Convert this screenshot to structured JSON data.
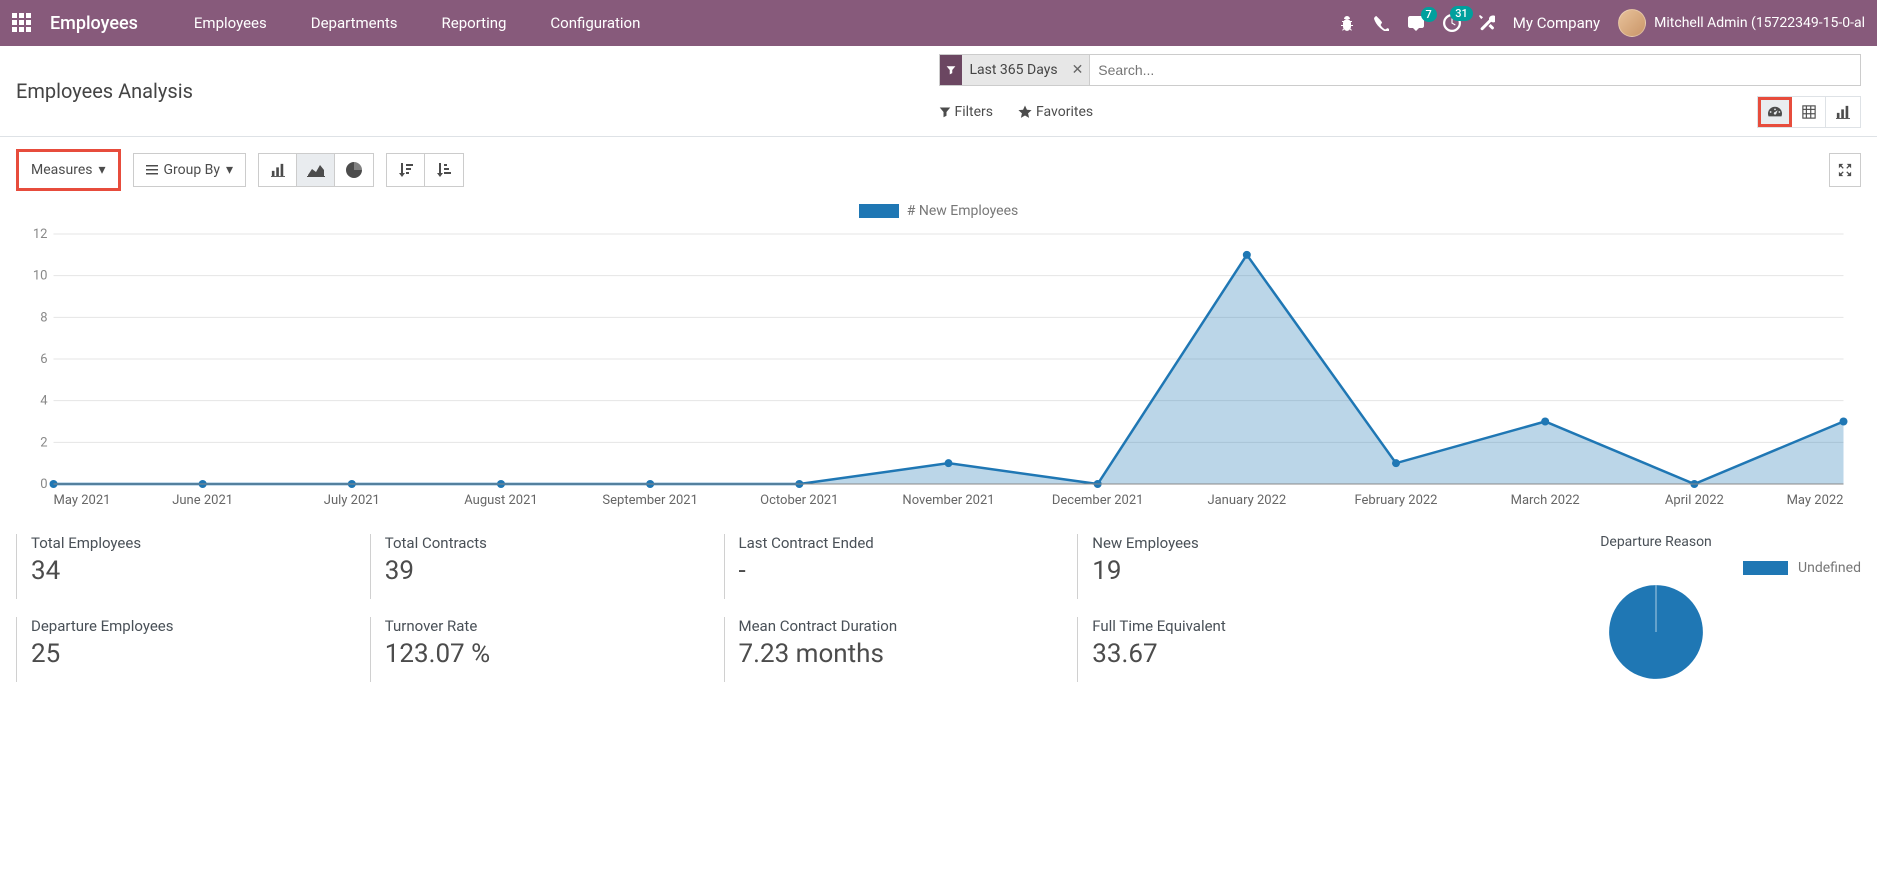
{
  "navbar": {
    "brand": "Employees",
    "links": [
      "Employees",
      "Departments",
      "Reporting",
      "Configuration"
    ],
    "msg_badge": "7",
    "act_badge": "31",
    "company": "My Company",
    "user": "Mitchell Admin (15722349-15-0-al"
  },
  "control": {
    "title": "Employees Analysis",
    "filter_tag": "Last 365 Days",
    "search_placeholder": "Search...",
    "filters_label": "Filters",
    "favorites_label": "Favorites"
  },
  "toolbar": {
    "measures_label": "Measures",
    "groupby_label": "Group By"
  },
  "chart_legend": "# New Employees",
  "chart_data": {
    "type": "area",
    "title": "# New Employees",
    "xlabel": "",
    "ylabel": "",
    "ylim": [
      0,
      12
    ],
    "yticks": [
      0,
      2,
      4,
      6,
      8,
      10,
      12
    ],
    "categories": [
      "May 2021",
      "June 2021",
      "July 2021",
      "August 2021",
      "September 2021",
      "October 2021",
      "November 2021",
      "December 2021",
      "January 2022",
      "February 2022",
      "March 2022",
      "April 2022",
      "May 2022"
    ],
    "series": [
      {
        "name": "# New Employees",
        "color": "#1f77b4",
        "values": [
          0,
          0,
          0,
          0,
          0,
          0,
          1,
          0,
          11,
          1,
          3,
          0,
          3
        ]
      }
    ]
  },
  "metrics": [
    {
      "label": "Total Employees",
      "value": "34"
    },
    {
      "label": "Total Contracts",
      "value": "39"
    },
    {
      "label": "Last Contract Ended",
      "value": "-"
    },
    {
      "label": "New Employees",
      "value": "19"
    },
    {
      "label": "Departure Employees",
      "value": "25"
    },
    {
      "label": "Turnover Rate",
      "value": "123.07 %"
    },
    {
      "label": "Mean Contract Duration",
      "value": "7.23 months"
    },
    {
      "label": "Full Time Equivalent",
      "value": "33.67"
    }
  ],
  "departure": {
    "title": "Departure Reason",
    "legend": "Undefined",
    "pie_color": "#1f77b4"
  }
}
